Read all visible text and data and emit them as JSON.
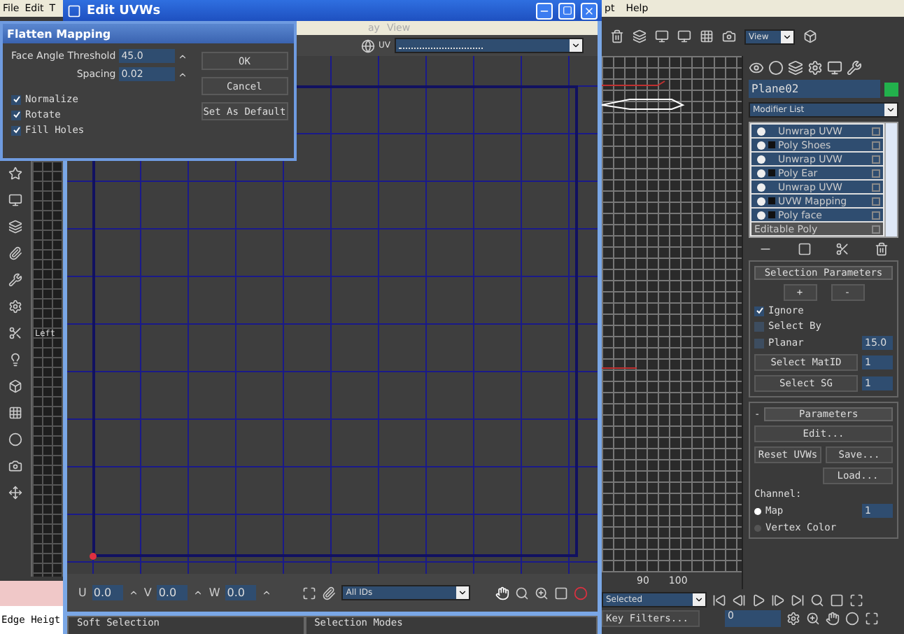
{
  "main_menu": {
    "left": [
      "File",
      "Edit",
      "T"
    ],
    "right": [
      "pt",
      "Help"
    ]
  },
  "left_viewport": {
    "label": "Left"
  },
  "edge_label": "Edge Heigt",
  "edit_uvws": {
    "title": "Edit UVWs",
    "menu": [
      "ay",
      "View"
    ],
    "channel_label": "UV",
    "coords": [
      {
        "label": "U",
        "value": "0.0"
      },
      {
        "label": "V",
        "value": "0.0"
      },
      {
        "label": "W",
        "value": "0.0"
      }
    ],
    "id_filter": "All IDs",
    "groups": [
      "Soft Selection",
      "Selection Modes"
    ]
  },
  "flatten_dialog": {
    "title": "Flatten Mapping",
    "fields": [
      {
        "label": "Face Angle Threshold",
        "value": "45.0"
      },
      {
        "label": "Spacing",
        "value": "0.02"
      }
    ],
    "checkboxes": [
      {
        "label": "Normalize",
        "checked": true
      },
      {
        "label": "Rotate",
        "checked": true
      },
      {
        "label": "Fill Holes",
        "checked": true
      }
    ],
    "buttons": [
      "OK",
      "Cancel",
      "Set As Default"
    ]
  },
  "viewport": {
    "ticks": [
      "90",
      "100"
    ]
  },
  "animation": {
    "key_mode": "Selected",
    "key_filters": "Key Filters...",
    "frame": "0"
  },
  "command_panel": {
    "view_dropdown": "View",
    "object_name": "Plane02",
    "modifier_list": "Modifier List",
    "stack": [
      {
        "name": "Unwrap UVW",
        "kind": "plain"
      },
      {
        "name": "Poly Shoes",
        "kind": "expandable"
      },
      {
        "name": "Unwrap UVW",
        "kind": "plain"
      },
      {
        "name": "Poly Ear",
        "kind": "expandable"
      },
      {
        "name": "Unwrap UVW",
        "kind": "plain"
      },
      {
        "name": "UVW Mapping",
        "kind": "expandable"
      },
      {
        "name": "Poly face",
        "kind": "expandable"
      },
      {
        "name": "Editable Poly",
        "kind": "base"
      }
    ],
    "selection_parameters": {
      "title": "Selection Parameters",
      "buttons": [
        "+",
        "-"
      ],
      "checks": [
        {
          "label": "Ignore",
          "checked": true
        },
        {
          "label": "Select By",
          "checked": false
        },
        {
          "label": "Planar",
          "checked": false
        }
      ],
      "planar_value": "15.0",
      "spinners": [
        {
          "label": "Select MatID",
          "value": "1"
        },
        {
          "label": "Select SG",
          "value": "1"
        }
      ]
    },
    "parameters": {
      "title": "Parameters",
      "sign": "-",
      "edit": "Edit...",
      "reset": "Reset UVWs",
      "save": "Save...",
      "load": "Load...",
      "channel_label": "Channel:",
      "options": [
        {
          "label": "Map",
          "selected": true,
          "value": "1"
        },
        {
          "label": "Vertex Color",
          "selected": false
        }
      ]
    }
  }
}
